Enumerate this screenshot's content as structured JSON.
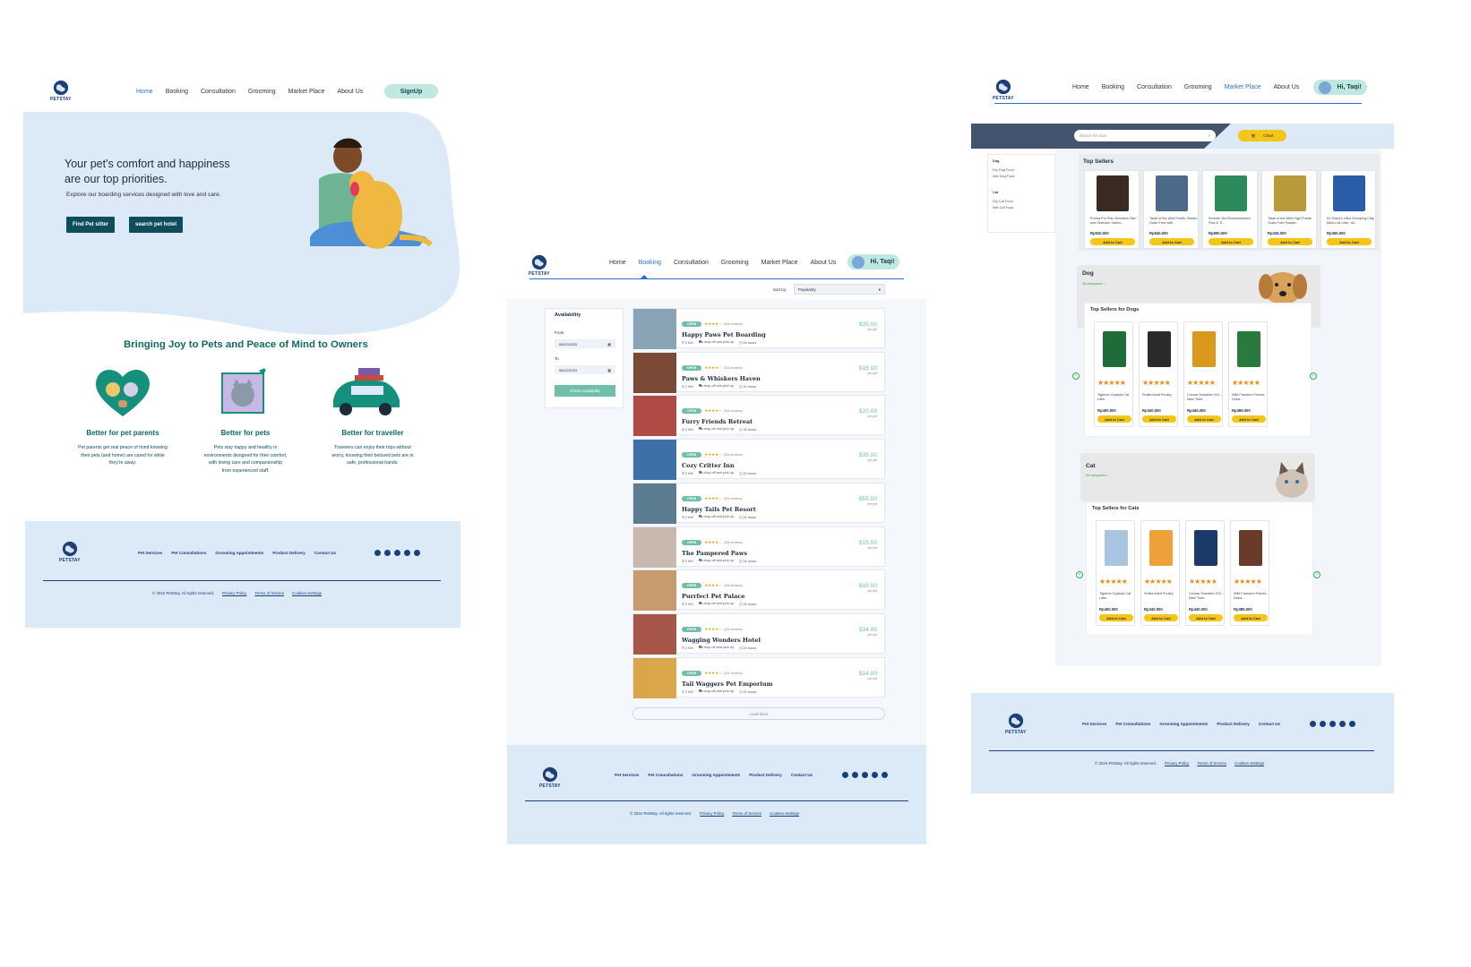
{
  "brand": {
    "name": "PETSTAY"
  },
  "colors": {
    "primary": "#0f4c5c",
    "light_blue": "#dce9f7",
    "accent_green": "#6fbfa9",
    "yellow": "#f5c518",
    "link_blue": "#2e6fd4"
  },
  "nav": [
    "Home",
    "Booking",
    "Consultation",
    "Grooming",
    "Market Place",
    "About Us"
  ],
  "page1": {
    "signup": "SignUp",
    "hero_title_1": "Your pet's comfort and happiness",
    "hero_title_2": "are our top priorities.",
    "hero_subtitle": "Explore our boarding services designed with love and care.",
    "btn_sitter": "Find Pet sitter",
    "btn_hotel": "search pet hotel",
    "section_title": "Bringing Joy to Pets and Peace of Mind to Owners",
    "features": [
      {
        "icon": "heart-family-icon",
        "title": "Better for pet parents",
        "lines": [
          "Pet parents get real peace of mind knowing",
          "their pets (and home) are cared for while",
          "they're away."
        ]
      },
      {
        "icon": "cat-portrait-icon",
        "title": "Better for pets",
        "lines": [
          "Pets stay happy and healthy in",
          "environments designed for their comfort,",
          "with loving care and companionship",
          "from experienced staff."
        ]
      },
      {
        "icon": "car-luggage-icon",
        "title": "Better for traveller",
        "lines": [
          "Travelers can enjoy their trips without",
          "worry, knowing their beloved pets are in",
          "safe, professional hands."
        ]
      }
    ]
  },
  "footer": {
    "links": [
      "Pet Services",
      "Pet Consultations",
      "Grooming Appointments",
      "Product Delivery",
      "Contact Us"
    ],
    "copyright": "© 2024 PetStay. All rights reserved.",
    "legal": [
      "Privacy Policy",
      "Terms of Service",
      "Cookies Settings"
    ],
    "social": [
      "facebook-icon",
      "instagram-icon",
      "x-icon",
      "linkedin-icon",
      "youtube-icon"
    ]
  },
  "user": {
    "greeting": "Hi, Taqi!"
  },
  "page2": {
    "sort_label": "Sort by:",
    "sort_value": "Popularity",
    "availability_title": "Availability",
    "from_label": "From",
    "to_label": "To",
    "from_date": "08/12/2023",
    "to_date": "08/12/2023",
    "check_btn": "Check Availability",
    "load_more": "Load More",
    "listings": [
      {
        "status": "OPEN",
        "stars": "★★★★☆",
        "reviews": "(334 reviews)",
        "name": "Happy Paws Pet Boarding",
        "distance": "2 KM",
        "pickup": "drop-off and pick up",
        "hours": "24 hours",
        "price": "$35.00",
        "unit": "per pet",
        "thumb": "#8aa3b5"
      },
      {
        "status": "OPEN",
        "stars": "★★★★☆",
        "reviews": "(334 reviews)",
        "name": "Paws & Whiskers Haven",
        "distance": "2 KM",
        "pickup": "drop-off and pick up",
        "hours": "24 hours",
        "price": "$15.00",
        "unit": "per pet",
        "thumb": "#7a4a36"
      },
      {
        "status": "OPEN",
        "stars": "★★★★☆",
        "reviews": "(334 reviews)",
        "name": "Furry Friends Retreat",
        "distance": "2 KM",
        "pickup": "drop-off and pick up",
        "hours": "24 hours",
        "price": "$20.00",
        "unit": "per pet",
        "thumb": "#b04a44"
      },
      {
        "status": "OPEN",
        "stars": "★★★★☆",
        "reviews": "(334 reviews)",
        "name": "Cozy Critter Inn",
        "distance": "2 KM",
        "pickup": "drop-off and pick up",
        "hours": "24 hours",
        "price": "$35.00",
        "unit": "per pet",
        "thumb": "#3f6fa8"
      },
      {
        "status": "OPEN",
        "stars": "★★★★☆",
        "reviews": "(334 reviews)",
        "name": "Happy Tails Pet Resort",
        "distance": "2 KM",
        "pickup": "drop-off and pick up",
        "hours": "24 hours",
        "price": "$55.00",
        "unit": "per pet",
        "thumb": "#5b7d8f"
      },
      {
        "status": "OPEN",
        "stars": "★★★★☆",
        "reviews": "(334 reviews)",
        "name": "The Pampered Paws",
        "distance": "2 KM",
        "pickup": "drop-off and pick up",
        "hours": "24 hours",
        "price": "$15.00",
        "unit": "per pet",
        "thumb": "#c9b8ad"
      },
      {
        "status": "OPEN",
        "stars": "★★★★☆",
        "reviews": "(334 reviews)",
        "name": "Purrfect Pet Palace",
        "distance": "2 KM",
        "pickup": "drop-off and pick up",
        "hours": "24 hours",
        "price": "$18.00",
        "unit": "per pet",
        "thumb": "#c79a6f"
      },
      {
        "status": "OPEN",
        "stars": "★★★★☆",
        "reviews": "(334 reviews)",
        "name": "Wagging Wonders Hotel",
        "distance": "2 KM",
        "pickup": "drop-off and pick up",
        "hours": "24 hours",
        "price": "$34.00",
        "unit": "per pet",
        "thumb": "#a7564a"
      },
      {
        "status": "OPEN",
        "stars": "★★★★☆",
        "reviews": "(334 reviews)",
        "name": "Tail Waggers Pet Emporium",
        "distance": "2 KM",
        "pickup": "drop-off and pick up",
        "hours": "24 hours",
        "price": "$14.00",
        "unit": "per pet",
        "thumb": "#d9a64a"
      }
    ]
  },
  "page3": {
    "search_placeholder": "Search the store",
    "chart_btn": "Chart",
    "sidebar": {
      "dog": "Dog",
      "dog_items": [
        "Dry Dog Food",
        "Wet Dog Food"
      ],
      "cat": "Cat",
      "cat_items": [
        "Dry Cat Food",
        "Wet Cat Food"
      ]
    },
    "top_sellers_title": "Top Sellers",
    "add_to_cart": "Add to Cart",
    "top_sellers": [
      {
        "name": "Purina Pro Plan Sensitive Skin and Stomach Salmo...",
        "price": "Rp520.000",
        "color": "#3b2a22"
      },
      {
        "name": "Taste of the Wild Pacific Stream Grain-Free with...",
        "price": "Rp545.000",
        "color": "#4b6a8a"
      },
      {
        "name": "Seresto Vet-Recommended Flea & Ti...",
        "price": "Rp890.000",
        "color": "#2c8a5a"
      },
      {
        "name": "Taste of the Wild High Prairie Grain-Free Roaste...",
        "price": "Rp245.000",
        "color": "#b89a3a"
      },
      {
        "name": "Dr. Elsey's Ultra Clumping Clay Multi-Cat Litter, 40...",
        "price": "Rp350.000",
        "color": "#2a5ca8"
      }
    ],
    "dog_section": {
      "title": "Dog",
      "all": "All categories",
      "sub": "Top Sellers for Dogs"
    },
    "cat_section": {
      "title": "Cat",
      "all": "All categories",
      "sub": "Top Sellers for Cats"
    },
    "dog_products": [
      {
        "name": "Tigerine Crystals Cat Litter",
        "price": "Rp400.000",
        "stars": "★★★★★",
        "color": "#1f6b3a"
      },
      {
        "name": "Smilla Adult Poultry",
        "price": "Rp340.000",
        "stars": "★★★★★",
        "color": "#2b2b2b"
      },
      {
        "name": "Cosma Snackies XXL - Maxi Tube",
        "price": "Rp440.000",
        "stars": "★★★★★",
        "color": "#d99a1a"
      },
      {
        "name": "Wild Freedom Freeze-Dried...",
        "price": "Rp385.000",
        "stars": "★★★★★",
        "color": "#2a7a3e"
      }
    ],
    "cat_products": [
      {
        "name": "Tigerine Crystals Cat Litter",
        "price": "Rp400.000",
        "stars": "★★★★★",
        "color": "#a9c4e0"
      },
      {
        "name": "Smilla Adult Poultry",
        "price": "Rp340.000",
        "stars": "★★★★★",
        "color": "#f0a23a"
      },
      {
        "name": "Cosma Snackies XXL - Maxi Tube",
        "price": "Rp440.000",
        "stars": "★★★★★",
        "color": "#1b3a6a"
      },
      {
        "name": "Wild Freedom Freeze-Dried...",
        "price": "Rp385.000",
        "stars": "★★★★★",
        "color": "#6a3a2a"
      }
    ]
  }
}
